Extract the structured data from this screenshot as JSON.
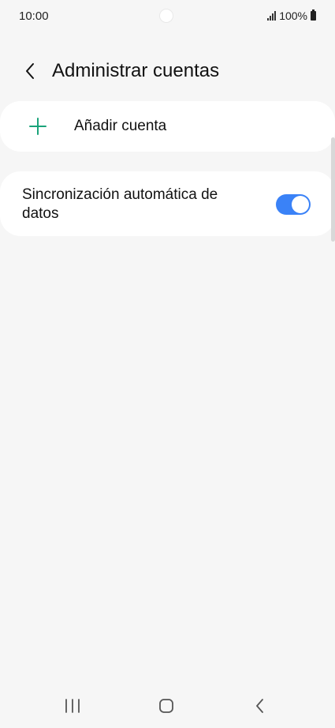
{
  "status_bar": {
    "time": "10:00",
    "battery_percent": "100%",
    "icons": [
      "signal-icon",
      "battery-icon"
    ]
  },
  "header": {
    "title": "Administrar cuentas",
    "back_icon": "chevron-left-icon"
  },
  "list": {
    "add_account": {
      "label": "Añadir cuenta",
      "icon": "plus-icon",
      "icon_color": "#1aa37a"
    },
    "auto_sync": {
      "label": "Sincronización automática de datos",
      "enabled": true,
      "toggle_color": "#3a82f7"
    }
  },
  "nav_bar": {
    "items": [
      "recent-apps-icon",
      "home-icon",
      "back-icon"
    ]
  }
}
